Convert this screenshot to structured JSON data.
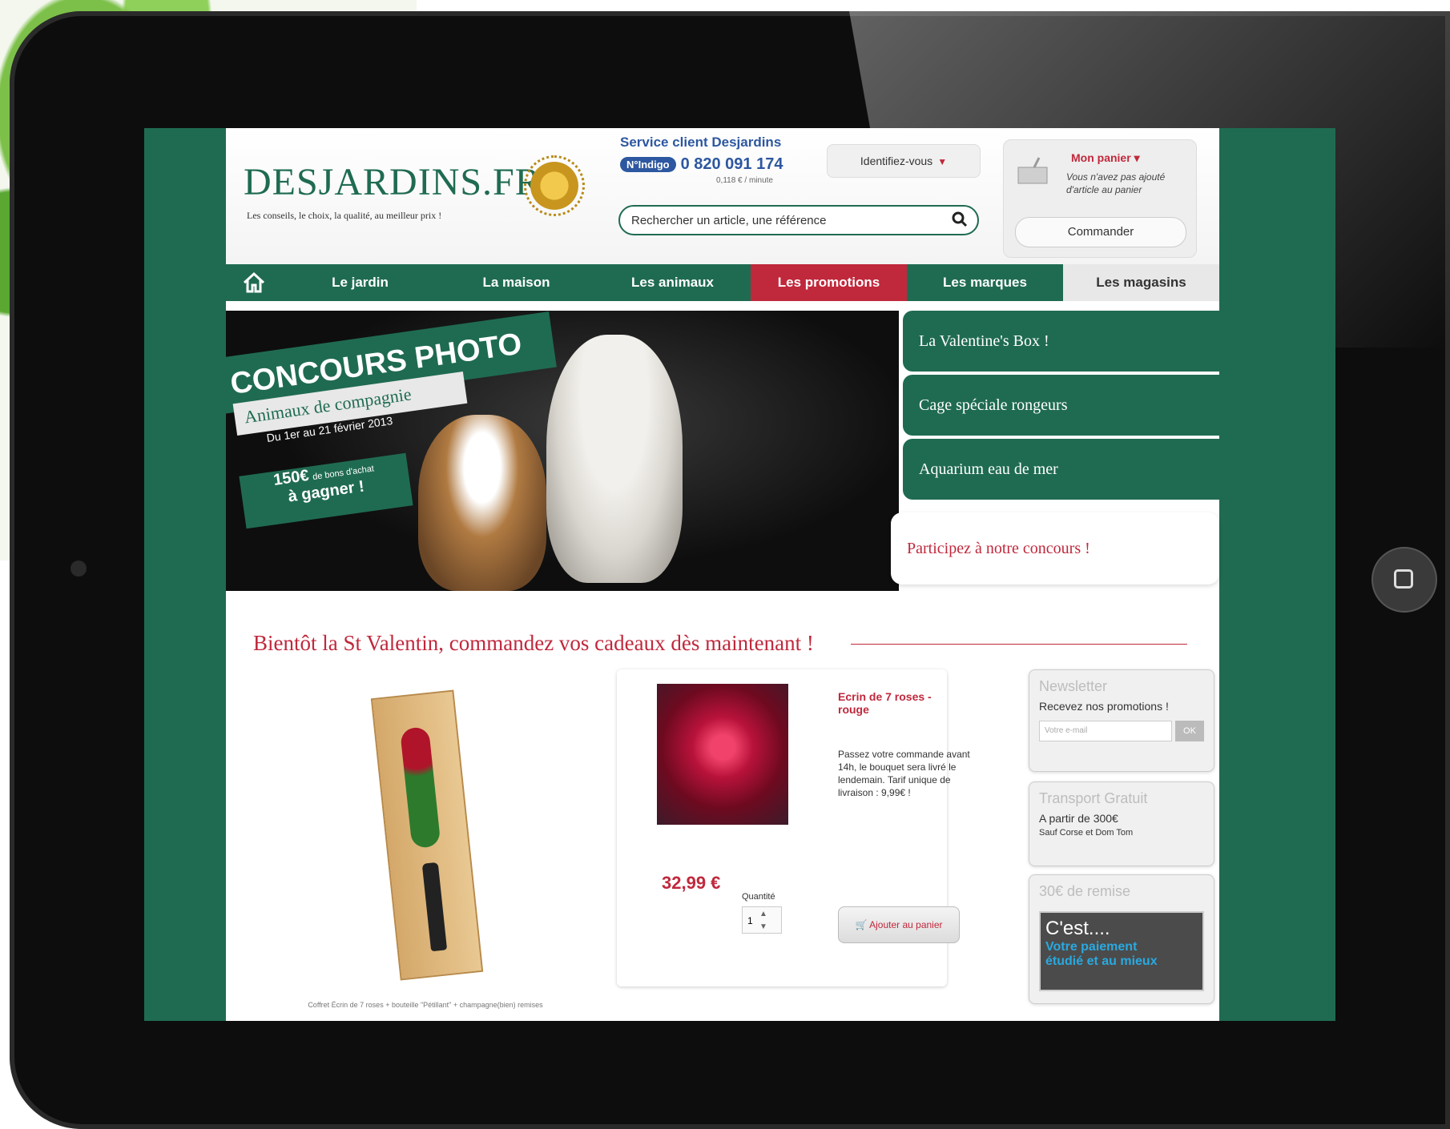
{
  "site": {
    "logo": "DESJARDINS.FR",
    "tagline": "Les conseils, le choix, la qualité, au meilleur prix !"
  },
  "service": {
    "title": "Service client Desjardins",
    "badge": "N°Indigo",
    "phone": "0 820 091 174",
    "rate": "0,118 € / minute"
  },
  "search": {
    "placeholder": "Rechercher un article, une référence"
  },
  "account": {
    "login_label": "Identifiez-vous"
  },
  "cart": {
    "title": "Mon panier",
    "note": "Vous n'avez pas ajouté d'article au panier",
    "order_label": "Commander"
  },
  "nav": {
    "items": [
      "Le jardin",
      "La maison",
      "Les animaux",
      "Les promotions",
      "Les marques",
      "Les magasins"
    ]
  },
  "banner": {
    "title": "CONCOURS PHOTO",
    "subtitle": "Animaux de compagnie",
    "dates": "Du 1er au 21 février 2013",
    "prize_amount": "150€",
    "prize_sub": "de bons d'achat",
    "prize_win": "à gagner !"
  },
  "side_links": [
    "La Valentine's Box !",
    "Cage spéciale rongeurs",
    "Aquarium eau de mer"
  ],
  "contest_link": "Participez à notre concours !",
  "section": {
    "title": "Bientôt la St Valentin, commandez vos cadeaux dès maintenant !"
  },
  "product": {
    "caption": "Coffret Écrin de 7 roses + bouteille \"Pétillant\" + champagne(bien) remises",
    "name": "Ecrin de 7 roses - rouge",
    "description": "Passez votre commande avant 14h, le bouquet sera livré le lendemain. Tarif unique de livraison : 9,99€ !",
    "price": "32,99 €",
    "qty_label": "Quantité",
    "qty_value": "1",
    "add_label": "Ajouter au panier"
  },
  "widgets": {
    "newsletter": {
      "title": "Newsletter",
      "text": "Recevez nos promotions !",
      "placeholder": "Votre e-mail",
      "ok": "OK"
    },
    "shipping": {
      "title": "Transport Gratuit",
      "text": "A partir de 300€",
      "note": "Sauf Corse et Dom Tom"
    },
    "discount": {
      "title": "30€ de remise",
      "line1": "C'est....",
      "line2": "Votre paiement",
      "line3": "étudié et au mieux"
    }
  }
}
